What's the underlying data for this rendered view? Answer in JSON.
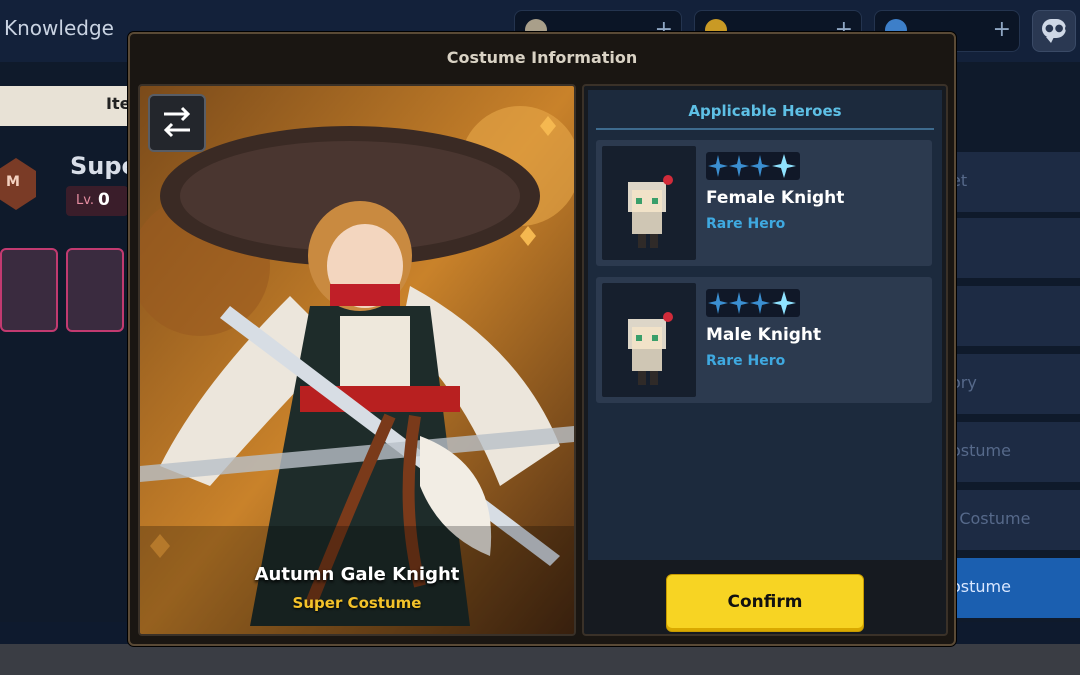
{
  "background": {
    "header_title": "Knowledge",
    "left_tab_label": "Ite",
    "partial_name": "Supe",
    "level_label": "Lv.",
    "level_value": "0",
    "right_menu": [
      {
        "label": "et"
      },
      {
        "label": ""
      },
      {
        "label": ""
      },
      {
        "label": "ory"
      },
      {
        "label": "ostume"
      },
      {
        "label": "ent Costume"
      },
      {
        "label": "ostume"
      }
    ],
    "colors": {
      "accent": "#1b5fb0",
      "frame_pink": "#c23a70"
    }
  },
  "modal": {
    "title": "Costume Information",
    "costume_name": "Autumn Gale Knight",
    "costume_grade": "Super Costume",
    "swap_icon": "swap-arrows-icon",
    "applicable_header": "Applicable Heroes",
    "heroes": [
      {
        "name": "Female Knight",
        "rarity": "Rare Hero",
        "stars": 4,
        "max_stars": 4
      },
      {
        "name": "Male Knight",
        "rarity": "Rare Hero",
        "stars": 4,
        "max_stars": 4
      }
    ],
    "confirm_label": "Confirm",
    "colors": {
      "confirm": "#f7d423",
      "grade": "#f3c22a",
      "rarity": "#3fa9e0",
      "header": "#5ec0e6"
    }
  }
}
